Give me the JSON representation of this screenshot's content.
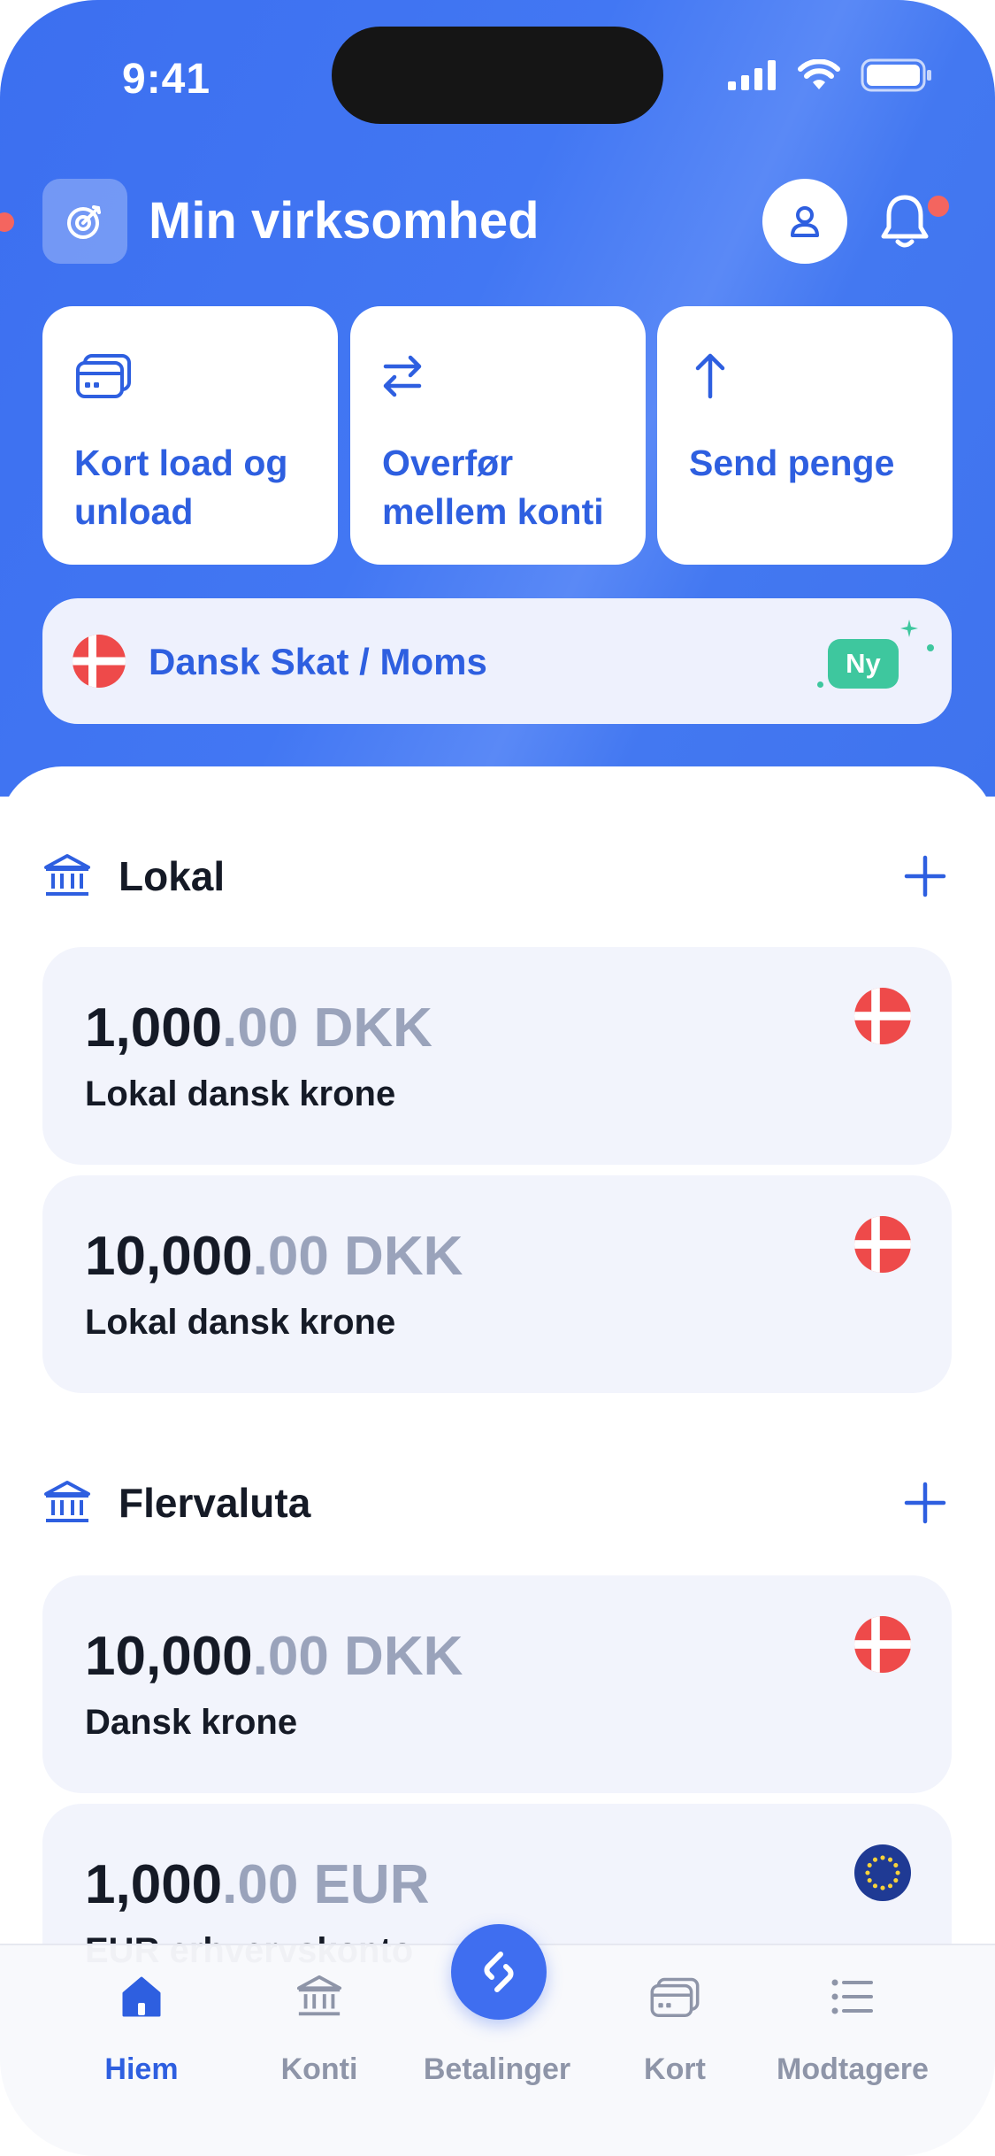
{
  "status_bar": {
    "time": "9:41"
  },
  "header": {
    "business_name": "Min virksomhed"
  },
  "quick_actions": [
    {
      "label": "Kort load og unload",
      "icon": "card-icon"
    },
    {
      "label": "Overfør mellem konti",
      "icon": "transfer-arrows-icon"
    },
    {
      "label": "Send penge",
      "icon": "arrow-up-icon"
    }
  ],
  "tax_banner": {
    "label": "Dansk Skat / Moms",
    "badge": "Ny"
  },
  "sections": [
    {
      "title": "Lokal",
      "accounts": [
        {
          "amount_int": "1,000",
          "amount_dec": ".00 DKK",
          "name": "Lokal dansk krone",
          "flag": "denmark"
        },
        {
          "amount_int": "10,000",
          "amount_dec": ".00 DKK",
          "name": "Lokal dansk krone",
          "flag": "denmark"
        }
      ]
    },
    {
      "title": "Flervaluta",
      "accounts": [
        {
          "amount_int": "10,000",
          "amount_dec": ".00 DKK",
          "name": "Dansk krone",
          "flag": "denmark"
        },
        {
          "amount_int": "1,000",
          "amount_dec": ".00 EUR",
          "name": "EUR erhvervskonto",
          "flag": "eu"
        }
      ]
    }
  ],
  "bottom_nav": [
    {
      "label": "Hiem",
      "icon": "home-icon",
      "active": true
    },
    {
      "label": "Konti",
      "icon": "bank-icon",
      "active": false
    },
    {
      "label": "Betalinger",
      "icon": "payments-icon",
      "active": false
    },
    {
      "label": "Kort",
      "icon": "card-icon",
      "active": false
    },
    {
      "label": "Modtagere",
      "icon": "list-icon",
      "active": false
    }
  ],
  "colors": {
    "brand_blue": "#3f6ef0",
    "accent_text": "#2e5fe0",
    "badge_green": "#3ec79e",
    "notification_red": "#f4655f"
  }
}
